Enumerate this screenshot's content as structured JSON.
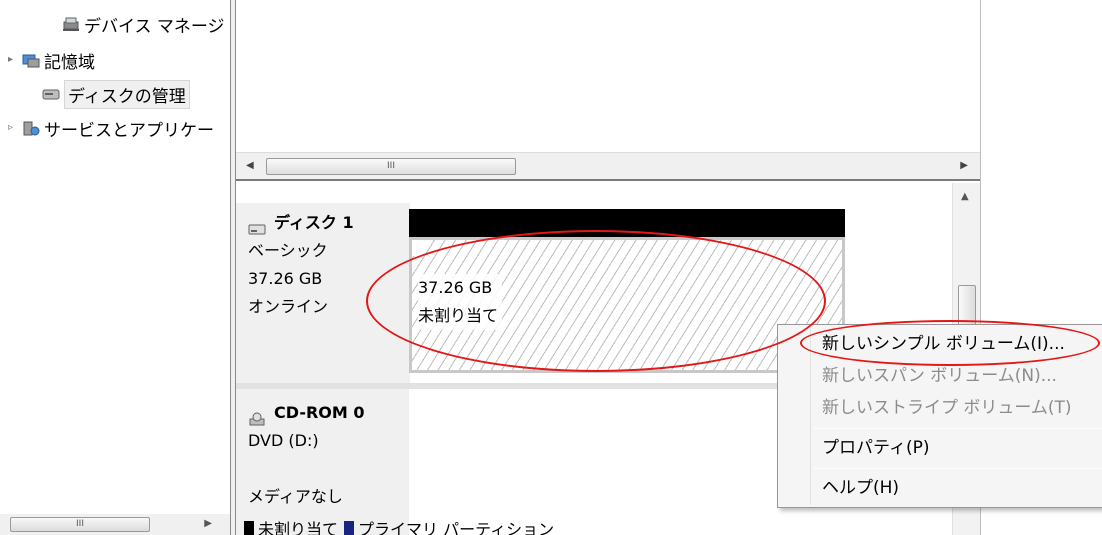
{
  "tree": {
    "items": [
      {
        "label": "デバイス マネージ",
        "icon": "device-manager-icon"
      },
      {
        "label": "記憶域",
        "icon": "storage-icon"
      },
      {
        "label": "ディスクの管理",
        "icon": "disk-management-icon"
      },
      {
        "label": "サービスとアプリケー",
        "icon": "services-icon"
      }
    ],
    "scroll_thumb": "III"
  },
  "top_scroll": {
    "thumb": "III"
  },
  "disks": [
    {
      "name": "ディスク 1",
      "type": "ベーシック",
      "size": "37.26 GB",
      "status": "オンライン",
      "icon": "disk-icon"
    },
    {
      "name": "CD-ROM 0",
      "drive": "DVD (D:)",
      "media": "メディアなし",
      "icon": "cdrom-icon"
    }
  ],
  "unallocated": {
    "size": "37.26 GB",
    "label": "未割り当て"
  },
  "legend": {
    "items": [
      {
        "label": "未割り当て",
        "color": "#000000"
      },
      {
        "label": "プライマリ パーティション",
        "color": "#1a237e"
      }
    ]
  },
  "context_menu": {
    "items": [
      {
        "label": "新しいシンプル ボリューム(I)...",
        "enabled": true
      },
      {
        "label": "新しいスパン ボリューム(N)...",
        "enabled": false
      },
      {
        "label": "新しいストライプ ボリューム(T)",
        "enabled": false
      },
      {
        "label": "プロパティ(P)",
        "enabled": true
      },
      {
        "label": "ヘルプ(H)",
        "enabled": true
      }
    ]
  },
  "annotation_color": "#e51616"
}
